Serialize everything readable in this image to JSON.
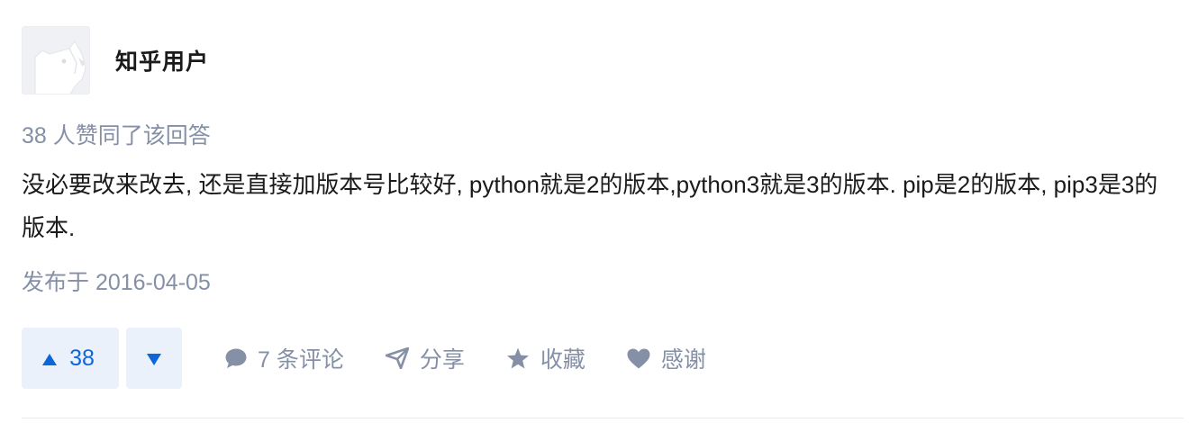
{
  "author": {
    "name": "知乎用户",
    "avatar_icon": "default-avatar-dog-icon"
  },
  "vote_summary": "38 人赞同了该回答",
  "content": "没必要改来改去, 还是直接加版本号比较好, python就是2的版本,python3就是3的版本. pip是2的版本, pip3是3的版本.",
  "published": "发布于 2016-04-05",
  "actions": {
    "upvote_count": "38",
    "upvote_icon": "triangle-up-icon",
    "downvote_icon": "triangle-down-icon",
    "comment_label": "7 条评论",
    "comment_icon": "comment-bubble-icon",
    "share_label": "分享",
    "share_icon": "paper-plane-icon",
    "favorite_label": "收藏",
    "favorite_icon": "star-icon",
    "thanks_label": "感谢",
    "thanks_icon": "heart-icon"
  },
  "colors": {
    "accent": "#0d66d8",
    "vote_bg": "#eaf1fb",
    "meta_gray": "#8590a6",
    "text": "#1a1a1a"
  }
}
